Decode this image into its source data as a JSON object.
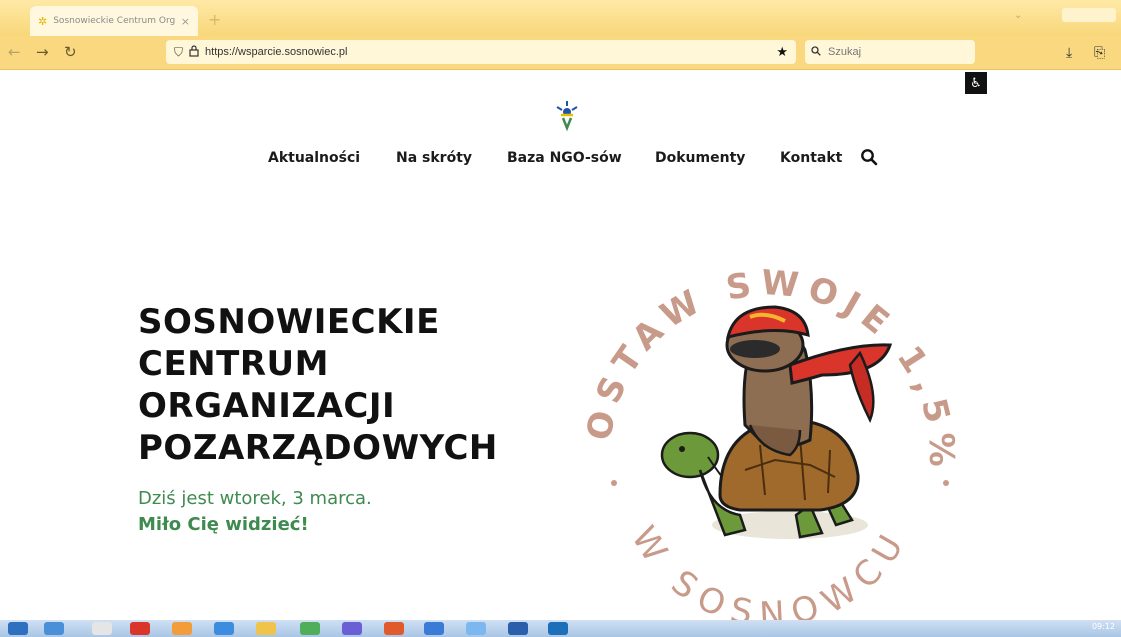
{
  "browser": {
    "tab_title": "Sosnowieckie Centrum Organiz",
    "tab_close": "×",
    "new_tab": "+",
    "url": "https://wsparcie.sosnowiec.pl",
    "search_placeholder": "Szukaj"
  },
  "site": {
    "nav": [
      "Aktualności",
      "Na skróty",
      "Baza NGO-sów",
      "Dokumenty",
      "Kontakt"
    ],
    "hero_title": "SOSNOWIECKIE\nCENTRUM\nORGANIZACJI\nPOZARZĄDOWYCH",
    "date_line": "Dziś jest wtorek, 3 marca.",
    "greeting": "Miło Cię widzieć!",
    "badge_top_text": "ZOSTAW SWOJE 1,5%",
    "badge_bottom_text": "W SOSNOWCU"
  },
  "taskbar": {
    "clock": "09:12"
  },
  "colors": {
    "accent_green": "#3e8a4f",
    "badge_text": "#c89a8a",
    "browser_chrome": "#f9d87f"
  },
  "icons": {
    "back": "arrow-left-icon",
    "forward": "arrow-right-icon",
    "reload": "reload-icon",
    "shield": "shield-icon",
    "lock": "lock-icon",
    "bookmark": "star-icon",
    "download": "download-icon",
    "extensions": "extensions-icon",
    "accessibility": "accessibility-icon",
    "search": "search-icon"
  }
}
